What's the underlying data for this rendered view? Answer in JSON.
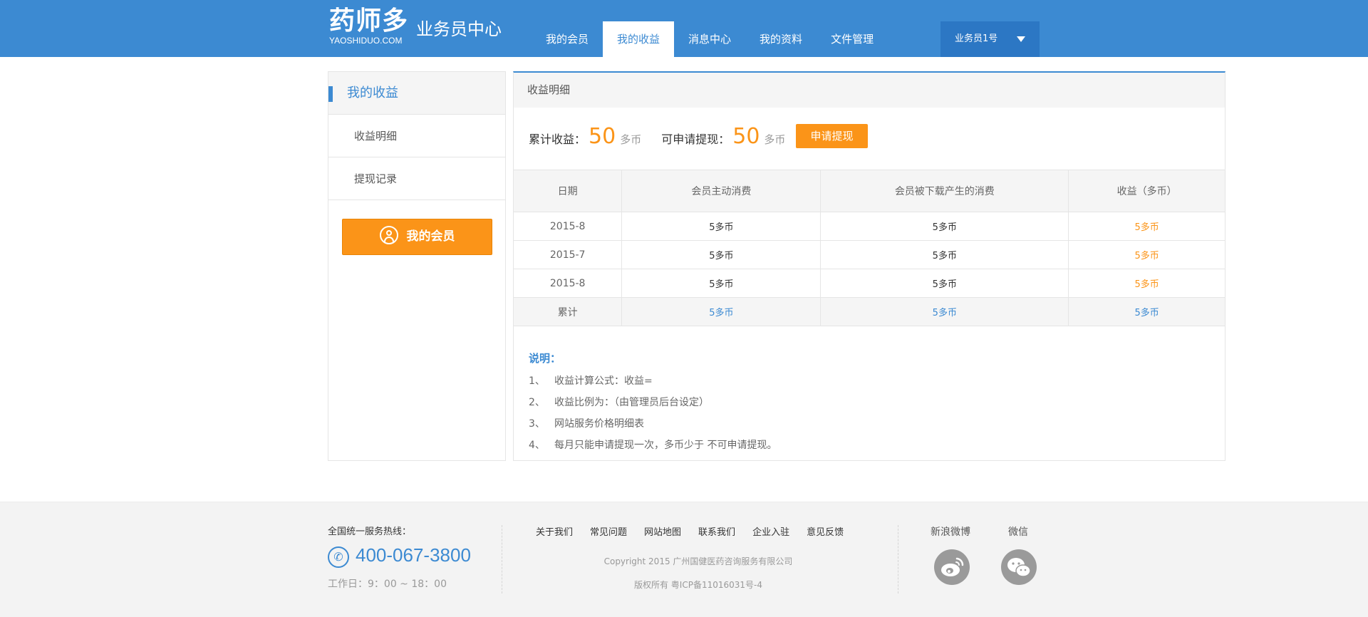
{
  "header": {
    "logo_main": "药师多",
    "logo_sub": "YAOSHIDUO.COM",
    "site_name": "业务员中心",
    "nav": [
      "我的会员",
      "我的收益",
      "消息中心",
      "我的资料",
      "文件管理"
    ],
    "active_nav": "我的收益",
    "user_name": "业务员1号"
  },
  "sidebar": {
    "title": "我的收益",
    "items": [
      "收益明细",
      "提现记录"
    ],
    "member_button": "我的会员"
  },
  "main": {
    "title": "收益明细",
    "total_label": "累计收益：",
    "total_value": "50",
    "total_unit": "多币",
    "withdrawable_label": "可申请提现：",
    "withdrawable_value": "50",
    "withdrawable_unit": "多币",
    "apply_button": "申请提现",
    "table": {
      "headers": [
        "日期",
        "会员主动消费",
        "会员被下载产生的消费",
        "收益（多币）"
      ],
      "rows": [
        [
          "2015-8",
          "5多币",
          "5多币",
          "5多币"
        ],
        [
          "2015-7",
          "5多币",
          "5多币",
          "5多币"
        ],
        [
          "2015-8",
          "5多币",
          "5多币",
          "5多币"
        ]
      ],
      "total_row": [
        "累计",
        "5多币",
        "5多币",
        "5多币"
      ]
    },
    "notes": {
      "title": "说明：",
      "items": [
        {
          "index": "1、",
          "text": "收益计算公式：收益="
        },
        {
          "index": "2、",
          "text": "收益比例为：（由管理员后台设定）"
        },
        {
          "index": "3、",
          "text": "网站服务价格明细表"
        },
        {
          "index": "4、",
          "text": "每月只能申请提现一次，多币少于  不可申请提现。"
        }
      ]
    }
  },
  "footer": {
    "hotline_label": "全国统一服务热线：",
    "phone": "400-067-3800",
    "workday": "工作日：9：00 ~ 18：00",
    "links": [
      "关于我们",
      "常见问题",
      "网站地图",
      "联系我们",
      "企业入驻",
      "意见反馈"
    ],
    "copyright": "Copyright 2015 广州国健医药咨询服务有限公司",
    "icp": "版权所有    粤ICP备11016031号-4",
    "weibo_label": "新浪微博",
    "wechat_label": "微信"
  },
  "colors": {
    "primary": "#3c8ad2",
    "accent": "#fb9418",
    "footer_bg": "#f3f3f3"
  },
  "icons": [
    "user-circle-icon",
    "phone-icon",
    "weibo-icon",
    "wechat-icon",
    "caret-down-icon"
  ]
}
